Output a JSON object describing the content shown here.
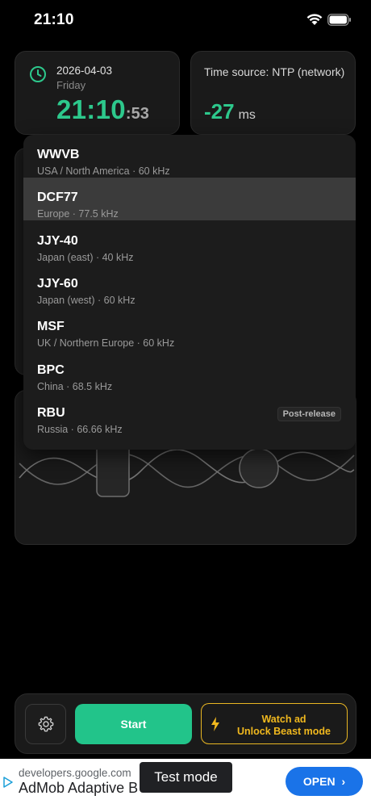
{
  "status_bar": {
    "time": "21:10"
  },
  "clock_card": {
    "date": "2026-04-03",
    "weekday": "Friday",
    "time_hm": "21:10",
    "time_sec": ":53"
  },
  "source_card": {
    "label": "Time source: NTP (network)",
    "offset": "-27",
    "unit": "ms"
  },
  "stations": [
    {
      "name": "WWVB",
      "detail": "USA / North America · 60 kHz",
      "badge": ""
    },
    {
      "name": "DCF77",
      "detail": "Europe · 77.5 kHz",
      "badge": "",
      "selected": true
    },
    {
      "name": "JJY-40",
      "detail": "Japan (east) · 40 kHz",
      "badge": ""
    },
    {
      "name": "JJY-60",
      "detail": "Japan (west) · 60 kHz",
      "badge": ""
    },
    {
      "name": "MSF",
      "detail": "UK / Northern Europe · 60 kHz",
      "badge": ""
    },
    {
      "name": "BPC",
      "detail": "China · 68.5 kHz",
      "badge": ""
    },
    {
      "name": "RBU",
      "detail": "Russia · 66.66 kHz",
      "badge": "Post-release"
    }
  ],
  "controls": {
    "start_label": "Start",
    "beast_line1": "Watch ad",
    "beast_line2": "Unlock Beast mode"
  },
  "ad": {
    "url": "developers.google.com",
    "title": "AdMob Adaptive B",
    "open_label": "OPEN",
    "test_mode": "Test mode"
  },
  "colors": {
    "accent_green": "#2dc88c",
    "button_green": "#22c48a",
    "accent_amber": "#f0b81e",
    "ad_blue": "#1a73e8"
  }
}
